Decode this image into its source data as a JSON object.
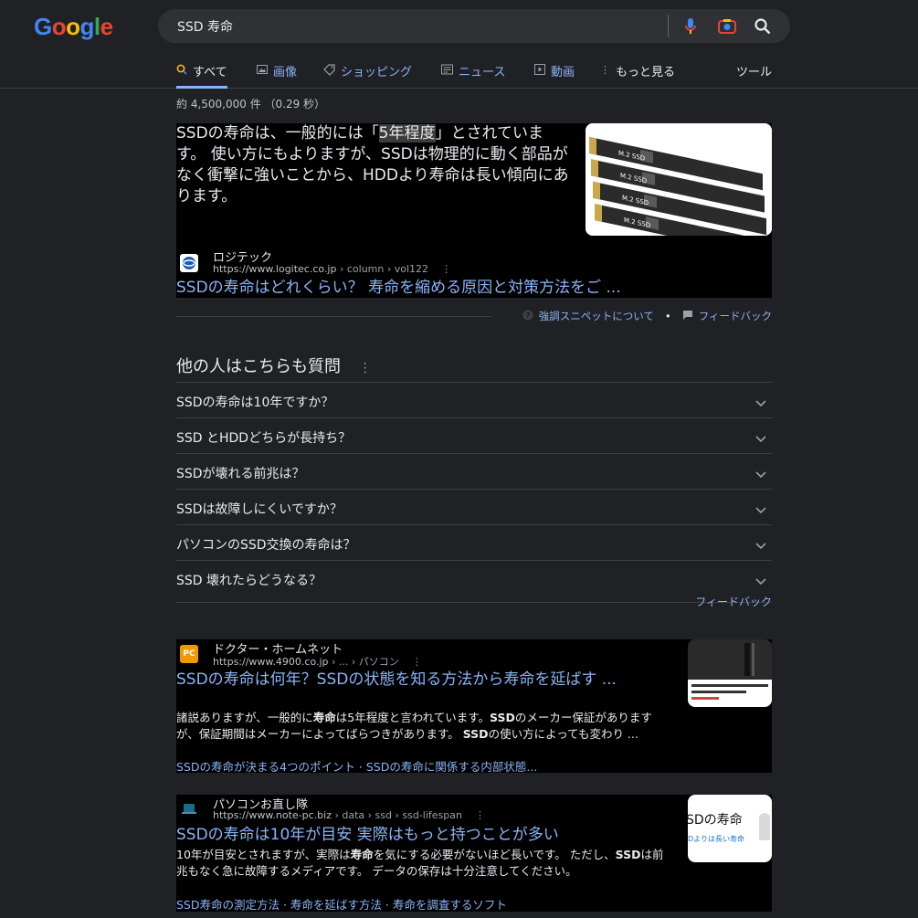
{
  "logo": "Google",
  "search": {
    "query": "SSD 寿命"
  },
  "tabs": [
    {
      "label": "すべて",
      "icon": "search-icon"
    },
    {
      "label": "画像",
      "icon": "image-icon"
    },
    {
      "label": "ショッピング",
      "icon": "tag-icon"
    },
    {
      "label": "ニュース",
      "icon": "news-icon"
    },
    {
      "label": "動画",
      "icon": "play-icon"
    },
    {
      "label": "もっと見る",
      "icon": "more-vert-icon"
    }
  ],
  "tools_label": "ツール",
  "stats": "約 4,500,000 件 （0.29 秒）",
  "featured": {
    "text_before": "SSDの寿命は、一般的には「",
    "text_highlight": "5年程度",
    "text_after": "」とされています。 使い方にもよりますが、SSDは物理的に動く部品がなく衝撃に強いことから、HDDより寿命は長い傾向にあります。",
    "image_labels": [
      "M.2 SSD",
      "M.2 SSD",
      "M.2 SSD",
      "M.2 SSD"
    ],
    "site_name": "ロジテック",
    "url_base": "https://www.logitec.co.jp",
    "url_path": " › column › vol122",
    "title": "SSDの寿命はどれくらい？ 寿命を縮める原因と対策方法をご ...",
    "about_label": "強調スニペットについて",
    "feedback_label": "フィードバック"
  },
  "paa": {
    "title": "他の人はこちらも質問",
    "questions": [
      "SSDの寿命は10年ですか？",
      "SSD とHDDどちらが長持ち？",
      "SSDが壊れる前兆は？",
      "SSDは故障しにくいですか？",
      "パソコンのSSD交換の寿命は？",
      "SSD 壊れたらどうなる？"
    ],
    "feedback_label": "フィードバック"
  },
  "results": [
    {
      "favicon": "PC",
      "site_name": "ドクター・ホームネット",
      "url_base": "https://www.4900.co.jp",
      "url_path": " › ... › パソコン",
      "title": "SSDの寿命は何年？SSDの状態を知る方法から寿命を延ばす ...",
      "snippet_1": "諸説ありますが、一般的に",
      "snippet_b1": "寿命",
      "snippet_2": "は5年程度と言われています。",
      "snippet_b2": "SSD",
      "snippet_3": "のメーカー保証がありますが、保証期間はメーカーによってばらつきがあります。 ",
      "snippet_b3": "SSD",
      "snippet_4": "の使い方によっても変わり ...",
      "sublink_1": "SSDの寿命が決まる4つのポイント",
      "sublink_2": "SSDの寿命に関係する内部状態..."
    },
    {
      "site_name": "パソコンお直し隊",
      "url_base": "https://www.note-pc.biz",
      "url_path": " › data › ssd › ssd-lifespan",
      "title": "SSDの寿命は10年が目安 実際はもっと持つことが多い",
      "snippet_1": "10年が目安とされますが、実際は",
      "snippet_b1": "寿命",
      "snippet_2": "を気にする必要がないほど長いです。 ただし、",
      "snippet_b2": "SSD",
      "snippet_3": "は前兆もなく急に故障するメディアです。 データの保存は十分注意してください。",
      "thumb_text_1": "SDの寿命",
      "thumb_text_2": "Dよりは長い寿命",
      "sublink_1": "SSD寿命の測定方法",
      "sublink_2": "寿命を延ばす方法",
      "sublink_3": "寿命を調査するソフト"
    }
  ],
  "colors": {
    "background": "#202124",
    "link": "#8ab4f8",
    "result_bg": "#000000"
  }
}
